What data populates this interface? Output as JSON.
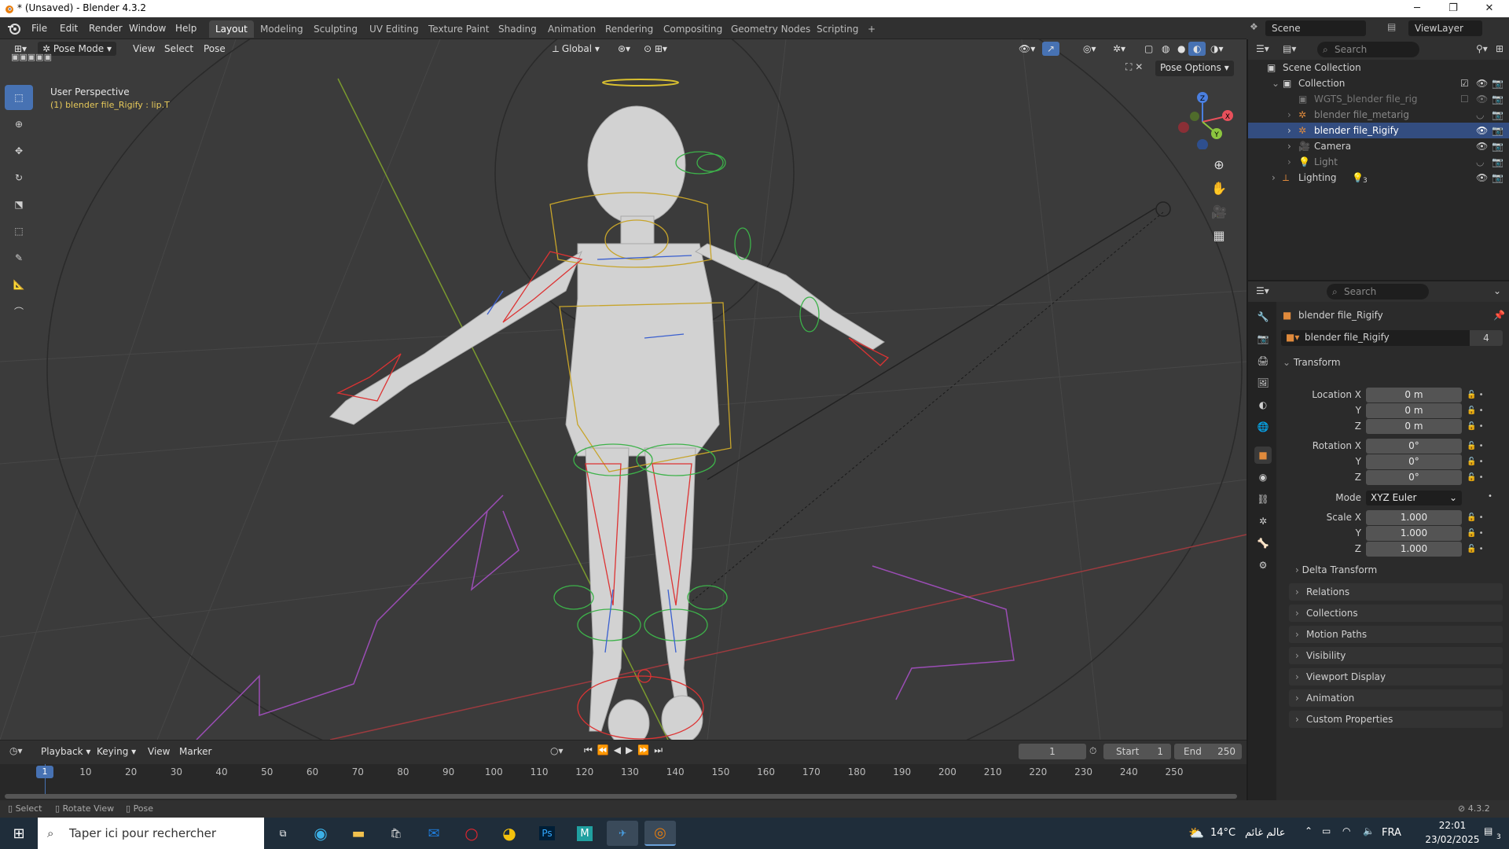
{
  "window": {
    "title": "* (Unsaved) - Blender 4.3.2"
  },
  "menu": [
    "File",
    "Edit",
    "Render",
    "Window",
    "Help"
  ],
  "workspaces": [
    "Layout",
    "Modeling",
    "Sculpting",
    "UV Editing",
    "Texture Paint",
    "Shading",
    "Animation",
    "Rendering",
    "Compositing",
    "Geometry Nodes",
    "Scripting"
  ],
  "workspace_add": "+",
  "scene": {
    "label": "Scene",
    "viewlayer": "ViewLayer"
  },
  "viewport": {
    "mode": "Pose Mode",
    "menus": [
      "View",
      "Select",
      "Pose"
    ],
    "orientation": "Global",
    "pose_options": "Pose Options",
    "info_title": "User Perspective",
    "info_object": "(1) blender file_Rigify : lip.T",
    "gizmo": {
      "x": "X",
      "y": "Y",
      "z": "Z"
    }
  },
  "outliner": {
    "search_placeholder": "Search",
    "rows": [
      {
        "label": "Scene Collection"
      },
      {
        "label": "Collection"
      },
      {
        "label": "WGTS_blender file_rig"
      },
      {
        "label": "blender file_metarig"
      },
      {
        "label": "blender file_Rigify"
      },
      {
        "label": "Camera"
      },
      {
        "label": "Light"
      },
      {
        "label": "Lighting"
      }
    ],
    "lighting_count": "3"
  },
  "properties": {
    "search_placeholder": "Search",
    "object_name": "blender file_Rigify",
    "data_name": "blender file_Rigify",
    "users": "4",
    "transform_label": "Transform",
    "location": {
      "label_x": "Location X",
      "label_y": "Y",
      "label_z": "Z",
      "x": "0 m",
      "y": "0 m",
      "z": "0 m"
    },
    "rotation": {
      "label_x": "Rotation X",
      "label_y": "Y",
      "label_z": "Z",
      "x": "0°",
      "y": "0°",
      "z": "0°"
    },
    "mode_label": "Mode",
    "mode_value": "XYZ Euler",
    "scale": {
      "label_x": "Scale X",
      "label_y": "Y",
      "label_z": "Z",
      "x": "1.000",
      "y": "1.000",
      "z": "1.000"
    },
    "delta_transform": "Delta Transform",
    "sections": [
      "Relations",
      "Collections",
      "Motion Paths",
      "Visibility",
      "Viewport Display",
      "Animation",
      "Custom Properties"
    ]
  },
  "timeline": {
    "menus": [
      "Playback",
      "Keying",
      "View",
      "Marker"
    ],
    "current_frame": "1",
    "start_label": "Start",
    "start": "1",
    "end_label": "End",
    "end": "250",
    "ticks": [
      "1",
      "10",
      "20",
      "30",
      "40",
      "50",
      "60",
      "70",
      "80",
      "90",
      "100",
      "110",
      "120",
      "130",
      "140",
      "150",
      "160",
      "170",
      "180",
      "190",
      "200",
      "210",
      "220",
      "230",
      "240",
      "250"
    ]
  },
  "statusbar": {
    "items": [
      "Select",
      "Rotate View",
      "Pose"
    ],
    "version": "4.3.2"
  },
  "taskbar": {
    "search_placeholder": "Taper ici pour rechercher",
    "weather": "14°C",
    "weather_text": "عالم غائم",
    "lang": "FRA",
    "time": "22:01",
    "date": "23/02/2025",
    "notifications": "3"
  },
  "colors": {
    "accent": "#4772b3",
    "selected_row": "#334d80",
    "x_axis": "#e8505b",
    "y_axis": "#8cc63f",
    "z_axis": "#4a7fe0"
  }
}
